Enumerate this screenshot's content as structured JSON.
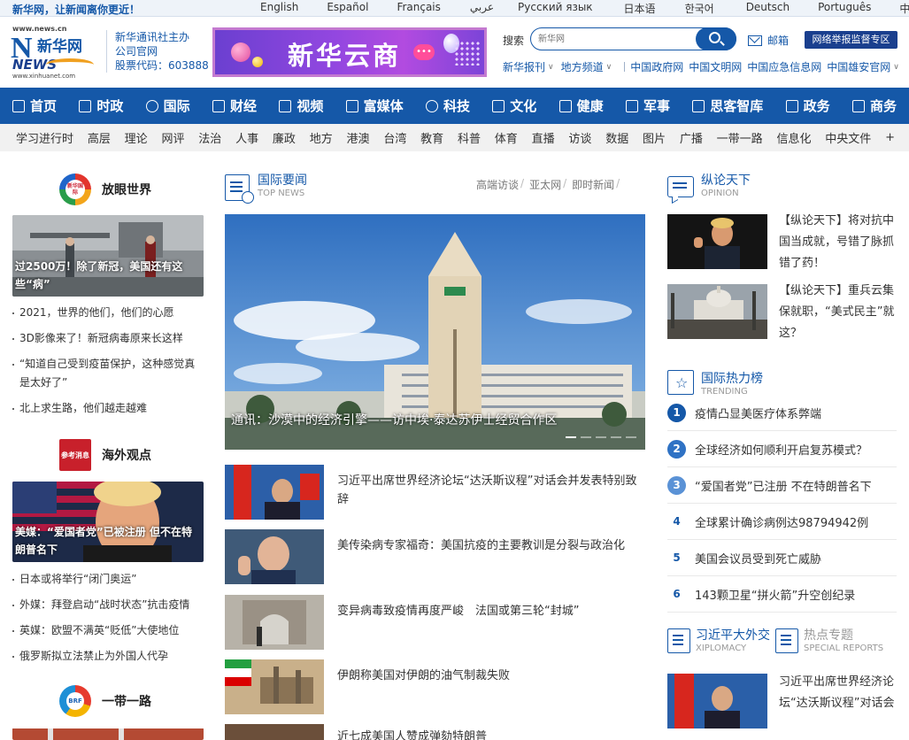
{
  "topbar": {
    "slogan": "新华网，让新闻离你更近！",
    "languages": [
      "English",
      "Español",
      "Français",
      "عربي",
      "Русский язык",
      "日本语",
      "한국어",
      "Deutsch",
      "Português",
      "中文/繁体"
    ]
  },
  "header": {
    "logo": {
      "site": "www.news.cn",
      "mark": "N",
      "name_cn": "新华网",
      "news": "NEWS",
      "url": "www.xinhuanet.com"
    },
    "org": {
      "line1": "新华通讯社主办",
      "line2": "公司官网",
      "stock": "股票代码：603888"
    },
    "banner_text": "新华云商",
    "search": {
      "label": "搜索",
      "placeholder": "新华网"
    },
    "mail_label": "邮箱",
    "report_label": "网络举报监督专区",
    "links": [
      {
        "label": "新华报刊",
        "caret": "∨"
      },
      {
        "label": "地方频道",
        "caret": "∨"
      },
      {
        "label": "中国政府网",
        "caret": ""
      },
      {
        "label": "中国文明网",
        "caret": ""
      },
      {
        "label": "中国应急信息网",
        "caret": ""
      },
      {
        "label": "中国雄安官网",
        "caret": "∨"
      }
    ]
  },
  "main_nav": [
    "首页",
    "时政",
    "国际",
    "财经",
    "视频",
    "富媒体",
    "科技",
    "文化",
    "健康",
    "军事",
    "思客智库",
    "政务",
    "商务"
  ],
  "sub_nav": [
    "学习进行时",
    "高层",
    "理论",
    "网评",
    "法治",
    "人事",
    "廉政",
    "地方",
    "港澳",
    "台湾",
    "教育",
    "科普",
    "体育",
    "直播",
    "访谈",
    "数据",
    "图片",
    "广播",
    "一带一路",
    "信息化",
    "中央文件",
    "+"
  ],
  "left": {
    "section1": {
      "logo_text": "新华国际",
      "title": "放眼世界",
      "photo_caption": "过2500万！除了新冠，美国还有这些“病”",
      "items": [
        "2021，世界的他们，他们的心愿",
        "3D影像来了！新冠病毒原来长这样",
        "“知道自己受到疫苗保护，这种感觉真是太好了”",
        "北上求生路，他们越走越难"
      ]
    },
    "section2": {
      "logo_text": "参考消息",
      "title": "海外观点",
      "photo_caption": "美媒：“爱国者党”已被注册 但不在特朗普名下",
      "items": [
        "日本或将举行“闭门奥运”",
        "外媒：拜登启动“战时状态”抗击疫情",
        "英媒：欧盟不满英“贬低”大使地位",
        "俄罗斯拟立法禁止为外国人代孕"
      ]
    },
    "section3": {
      "logo_text": "BRF",
      "title": "一带一路"
    }
  },
  "center": {
    "title": "国际要闻",
    "title_en": "TOP NEWS",
    "tabs": [
      "高端访谈",
      "亚太网",
      "即时新闻"
    ],
    "hero_caption": "通讯：沙漠中的经济引擎——访中埃·泰达苏伊士经贸合作区",
    "hero_slide_count": 5,
    "hero_active_slide": 1,
    "news": [
      "习近平出席世界经济论坛“达沃斯议程”对话会并发表特别致辞",
      "美传染病专家福奇：美国抗疫的主要教训是分裂与政治化",
      "变异病毒致疫情再度严峻　法国或第三轮“封城”",
      "伊朗称美国对伊朗的油气制裁失败",
      "近七成美国人赞成弹劾特朗普"
    ]
  },
  "right": {
    "opinion": {
      "title": "纵论天下",
      "title_en": "OPINION",
      "items": [
        "【纵论天下】将对抗中国当成就，号错了脉抓错了药！",
        "【纵论天下】重兵云集保就职，“美式民主”就这？"
      ]
    },
    "trending": {
      "title": "国际热力榜",
      "title_en": "TRENDING",
      "items": [
        {
          "rank": "1",
          "text": "疫情凸显美医疗体系弊端"
        },
        {
          "rank": "2",
          "text": "全球经济如何顺利开启复苏模式？"
        },
        {
          "rank": "3",
          "text": "“爱国者党”已注册 不在特朗普名下"
        },
        {
          "rank": "4",
          "text": "全球累计确诊病例达98794942例"
        },
        {
          "rank": "5",
          "text": "美国会议员受到死亡威胁"
        },
        {
          "rank": "6",
          "text": "143颗卫星“拼火箭”升空创纪录"
        }
      ]
    },
    "xiplomacy": {
      "tab1": "习近平大外交",
      "tab1_en": "XIPLOMACY",
      "tab2": "热点专题",
      "tab2_en": "SPECIAL REPORTS",
      "item": "习近平出席世界经济论坛“达沃斯议程”对话会"
    }
  },
  "colors": {
    "brand_blue": "#1558a8",
    "nav_dark": "#1a3f8e",
    "banner_purple": "#9347e0"
  }
}
